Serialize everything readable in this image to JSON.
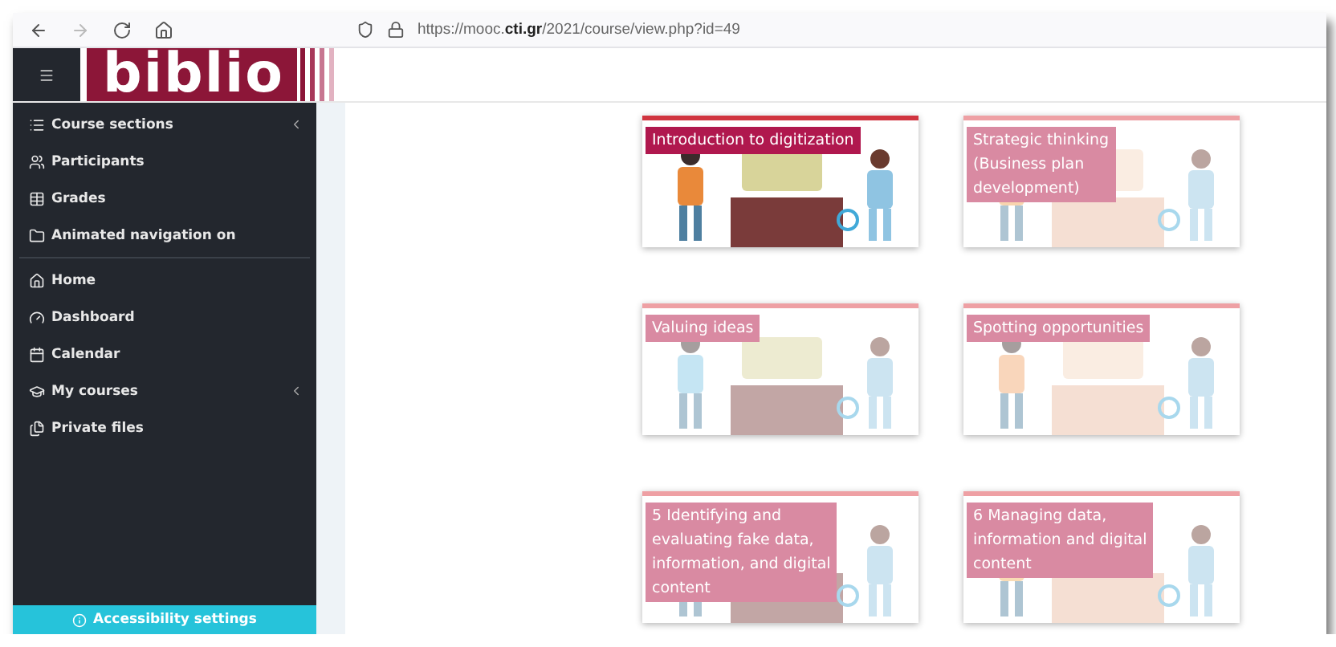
{
  "browser": {
    "nav_buttons": [
      {
        "disabled": false
      },
      {
        "disabled": true
      },
      {
        "disabled": false
      },
      {
        "disabled": false
      }
    ],
    "url": "https://mooc.**cti.gr**/2021/course/view.php?id=49"
  },
  "header": {
    "logo_text": "biblio"
  },
  "sidebar": {
    "sections": [
      {
        "items": [
          {
            "label": "Course sections",
            "has_submenu": true
          },
          {
            "label": "Participants",
            "has_submenu": false
          },
          {
            "label": "Grades",
            "has_submenu": false
          },
          {
            "label": "Animated navigation on",
            "has_submenu": false
          }
        ]
      },
      {
        "items": [
          {
            "label": "Home",
            "has_submenu": false
          },
          {
            "label": "Dashboard",
            "has_submenu": false
          },
          {
            "label": "Calendar",
            "has_submenu": false
          },
          {
            "label": "My courses",
            "has_submenu": true
          },
          {
            "label": "Private files",
            "has_submenu": false
          }
        ]
      }
    ],
    "footer": "Accessibility settings"
  },
  "cards": [
    {
      "title": "Introduction to digitization",
      "highlighted": true
    },
    {
      "title": "Strategic thinking\n(Business plan\ndevelopment)",
      "highlighted": false
    },
    {
      "title": "Valuing ideas",
      "highlighted": false
    },
    {
      "title": "Spotting opportunities",
      "highlighted": false
    },
    {
      "title": "5 Identifying and\nevaluating fake data,\ninformation, and digital\ncontent",
      "highlighted": false
    },
    {
      "title": "6 Managing data,\ninformation and digital\ncontent",
      "highlighted": false
    }
  ]
}
